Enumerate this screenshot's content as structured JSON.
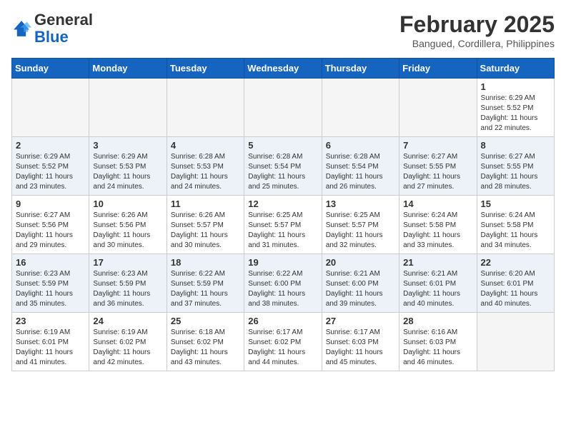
{
  "logo": {
    "general": "General",
    "blue": "Blue"
  },
  "title": {
    "month_year": "February 2025",
    "location": "Bangued, Cordillera, Philippines"
  },
  "days_of_week": [
    "Sunday",
    "Monday",
    "Tuesday",
    "Wednesday",
    "Thursday",
    "Friday",
    "Saturday"
  ],
  "weeks": [
    [
      {
        "day": null,
        "info": null
      },
      {
        "day": null,
        "info": null
      },
      {
        "day": null,
        "info": null
      },
      {
        "day": null,
        "info": null
      },
      {
        "day": null,
        "info": null
      },
      {
        "day": null,
        "info": null
      },
      {
        "day": "1",
        "info": "Sunrise: 6:29 AM\nSunset: 5:52 PM\nDaylight: 11 hours\nand 22 minutes."
      }
    ],
    [
      {
        "day": "2",
        "info": "Sunrise: 6:29 AM\nSunset: 5:52 PM\nDaylight: 11 hours\nand 23 minutes."
      },
      {
        "day": "3",
        "info": "Sunrise: 6:29 AM\nSunset: 5:53 PM\nDaylight: 11 hours\nand 24 minutes."
      },
      {
        "day": "4",
        "info": "Sunrise: 6:28 AM\nSunset: 5:53 PM\nDaylight: 11 hours\nand 24 minutes."
      },
      {
        "day": "5",
        "info": "Sunrise: 6:28 AM\nSunset: 5:54 PM\nDaylight: 11 hours\nand 25 minutes."
      },
      {
        "day": "6",
        "info": "Sunrise: 6:28 AM\nSunset: 5:54 PM\nDaylight: 11 hours\nand 26 minutes."
      },
      {
        "day": "7",
        "info": "Sunrise: 6:27 AM\nSunset: 5:55 PM\nDaylight: 11 hours\nand 27 minutes."
      },
      {
        "day": "8",
        "info": "Sunrise: 6:27 AM\nSunset: 5:55 PM\nDaylight: 11 hours\nand 28 minutes."
      }
    ],
    [
      {
        "day": "9",
        "info": "Sunrise: 6:27 AM\nSunset: 5:56 PM\nDaylight: 11 hours\nand 29 minutes."
      },
      {
        "day": "10",
        "info": "Sunrise: 6:26 AM\nSunset: 5:56 PM\nDaylight: 11 hours\nand 30 minutes."
      },
      {
        "day": "11",
        "info": "Sunrise: 6:26 AM\nSunset: 5:57 PM\nDaylight: 11 hours\nand 30 minutes."
      },
      {
        "day": "12",
        "info": "Sunrise: 6:25 AM\nSunset: 5:57 PM\nDaylight: 11 hours\nand 31 minutes."
      },
      {
        "day": "13",
        "info": "Sunrise: 6:25 AM\nSunset: 5:57 PM\nDaylight: 11 hours\nand 32 minutes."
      },
      {
        "day": "14",
        "info": "Sunrise: 6:24 AM\nSunset: 5:58 PM\nDaylight: 11 hours\nand 33 minutes."
      },
      {
        "day": "15",
        "info": "Sunrise: 6:24 AM\nSunset: 5:58 PM\nDaylight: 11 hours\nand 34 minutes."
      }
    ],
    [
      {
        "day": "16",
        "info": "Sunrise: 6:23 AM\nSunset: 5:59 PM\nDaylight: 11 hours\nand 35 minutes."
      },
      {
        "day": "17",
        "info": "Sunrise: 6:23 AM\nSunset: 5:59 PM\nDaylight: 11 hours\nand 36 minutes."
      },
      {
        "day": "18",
        "info": "Sunrise: 6:22 AM\nSunset: 5:59 PM\nDaylight: 11 hours\nand 37 minutes."
      },
      {
        "day": "19",
        "info": "Sunrise: 6:22 AM\nSunset: 6:00 PM\nDaylight: 11 hours\nand 38 minutes."
      },
      {
        "day": "20",
        "info": "Sunrise: 6:21 AM\nSunset: 6:00 PM\nDaylight: 11 hours\nand 39 minutes."
      },
      {
        "day": "21",
        "info": "Sunrise: 6:21 AM\nSunset: 6:01 PM\nDaylight: 11 hours\nand 40 minutes."
      },
      {
        "day": "22",
        "info": "Sunrise: 6:20 AM\nSunset: 6:01 PM\nDaylight: 11 hours\nand 40 minutes."
      }
    ],
    [
      {
        "day": "23",
        "info": "Sunrise: 6:19 AM\nSunset: 6:01 PM\nDaylight: 11 hours\nand 41 minutes."
      },
      {
        "day": "24",
        "info": "Sunrise: 6:19 AM\nSunset: 6:02 PM\nDaylight: 11 hours\nand 42 minutes."
      },
      {
        "day": "25",
        "info": "Sunrise: 6:18 AM\nSunset: 6:02 PM\nDaylight: 11 hours\nand 43 minutes."
      },
      {
        "day": "26",
        "info": "Sunrise: 6:17 AM\nSunset: 6:02 PM\nDaylight: 11 hours\nand 44 minutes."
      },
      {
        "day": "27",
        "info": "Sunrise: 6:17 AM\nSunset: 6:03 PM\nDaylight: 11 hours\nand 45 minutes."
      },
      {
        "day": "28",
        "info": "Sunrise: 6:16 AM\nSunset: 6:03 PM\nDaylight: 11 hours\nand 46 minutes."
      },
      {
        "day": null,
        "info": null
      }
    ]
  ]
}
